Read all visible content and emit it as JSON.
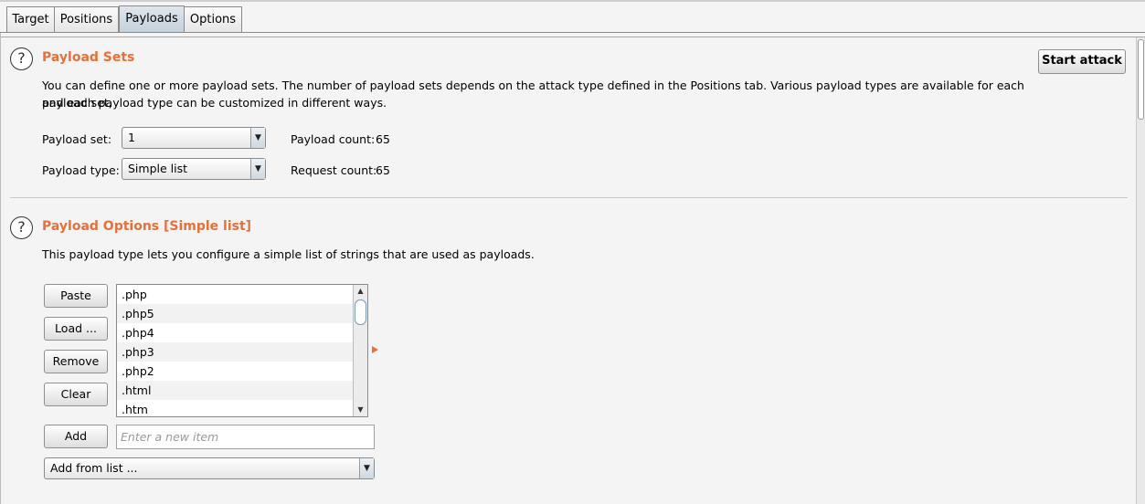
{
  "tabs": [
    "Target",
    "Positions",
    "Payloads",
    "Options"
  ],
  "active_tab": "Payloads",
  "payload_sets": {
    "title": "Payload Sets",
    "desc_line1": "You can define one or more payload sets. The number of payload sets depends on the attack type defined in the Positions tab. Various payload types are available for each payload set,",
    "desc_line2": "and each payload type can be customized in different ways.",
    "set_label": "Payload set:",
    "set_value": "1",
    "type_label": "Payload type:",
    "type_value": "Simple list",
    "payload_count_label": "Payload count:",
    "payload_count": "65",
    "request_count_label": "Request count:",
    "request_count": "65",
    "start_attack": "Start attack"
  },
  "payload_options": {
    "title": "Payload Options [Simple list]",
    "desc": "This payload type lets you configure a simple list of strings that are used as payloads.",
    "buttons": {
      "paste": "Paste",
      "load": "Load ...",
      "remove": "Remove",
      "clear": "Clear",
      "add": "Add"
    },
    "items": [
      ".php",
      ".php5",
      ".php4",
      ".php3",
      ".php2",
      ".html",
      ".htm"
    ],
    "new_item_placeholder": "Enter a new item",
    "add_from_list": "Add from list ..."
  },
  "icons": {
    "help": "?",
    "dropdown": "▼",
    "scroll_up": "▲",
    "scroll_down": "▼"
  },
  "colors": {
    "accent": "#e8703a"
  }
}
